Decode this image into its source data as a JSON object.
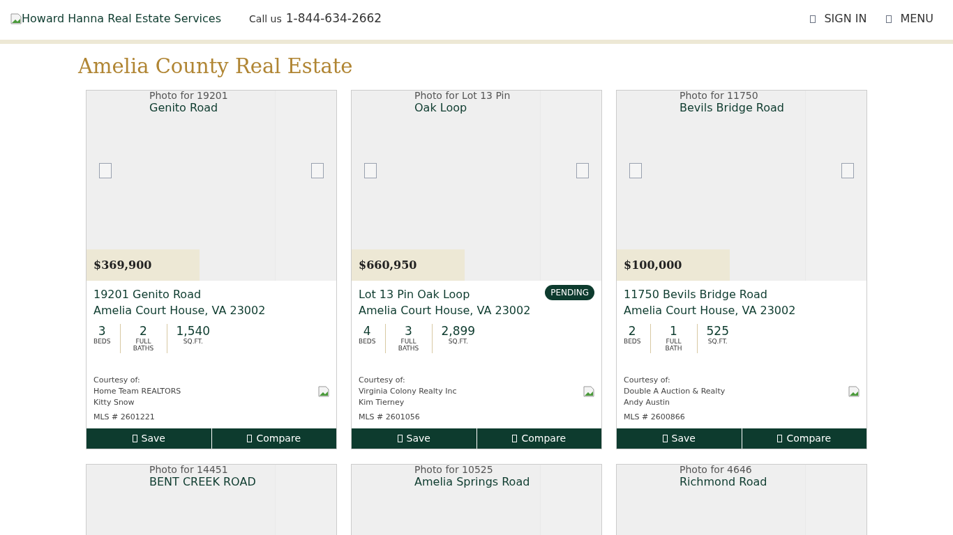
{
  "header": {
    "logo_alt": "Howard Hanna Real Estate Services",
    "call_label": "Call us",
    "phone": "1-844-634-2662",
    "nav": [
      {
        "label": "SIGN IN"
      },
      {
        "label": "MENU"
      }
    ]
  },
  "title": "Amelia County Real Estate",
  "listings": [
    {
      "photo_alt": [
        "Photo for 19201",
        "Genito Road"
      ],
      "price": "$369,900",
      "address_line1": "19201 Genito Road",
      "address_line2": "Amelia Court House, VA 23002",
      "stats": [
        {
          "value": "3",
          "label": "BEDS"
        },
        {
          "value": "2",
          "label": "FULL BATHS"
        },
        {
          "value": "1,540",
          "label": "SQ.FT."
        }
      ],
      "courtesy_label": "Courtesy of:",
      "office": "Home Team REALTORS",
      "agent": "Kitty Snow",
      "mls": "MLS # 2601221",
      "actions": [
        "Save",
        "Compare"
      ]
    },
    {
      "photo_alt": [
        "Photo for Lot 13 Pin",
        "Oak Loop"
      ],
      "price": "$660,950",
      "address_line1": "Lot 13 Pin Oak Loop",
      "address_line2": "Amelia Court House, VA 23002",
      "status": "PENDING",
      "stats": [
        {
          "value": "4",
          "label": "BEDS"
        },
        {
          "value": "3",
          "label": "FULL BATHS"
        },
        {
          "value": "2,899",
          "label": "SQ.FT."
        }
      ],
      "courtesy_label": "Courtesy of:",
      "office": "Virginia Colony Realty Inc",
      "agent": "Kim Tierney",
      "mls": "MLS # 2601056",
      "actions": [
        "Save",
        "Compare"
      ]
    },
    {
      "photo_alt": [
        "Photo for 11750",
        "Bevils Bridge Road"
      ],
      "price": "$100,000",
      "address_line1": "11750 Bevils Bridge Road",
      "address_line2": "Amelia Court House, VA 23002",
      "stats": [
        {
          "value": "2",
          "label": "BEDS"
        },
        {
          "value": "1",
          "label": "FULL BATH"
        },
        {
          "value": "525",
          "label": "SQ.FT."
        }
      ],
      "courtesy_label": "Courtesy of:",
      "office": "Double A Auction & Realty",
      "agent": "Andy Austin",
      "mls": "MLS # 2600866",
      "actions": [
        "Save",
        "Compare"
      ]
    }
  ],
  "more_listings": [
    {
      "photo_alt": [
        "Photo for 14451",
        "BENT CREEK ROAD"
      ]
    },
    {
      "photo_alt": [
        "Photo for 10525",
        "Amelia Springs Road"
      ]
    },
    {
      "photo_alt": [
        "Photo for 4646",
        "Richmond Road"
      ]
    }
  ]
}
